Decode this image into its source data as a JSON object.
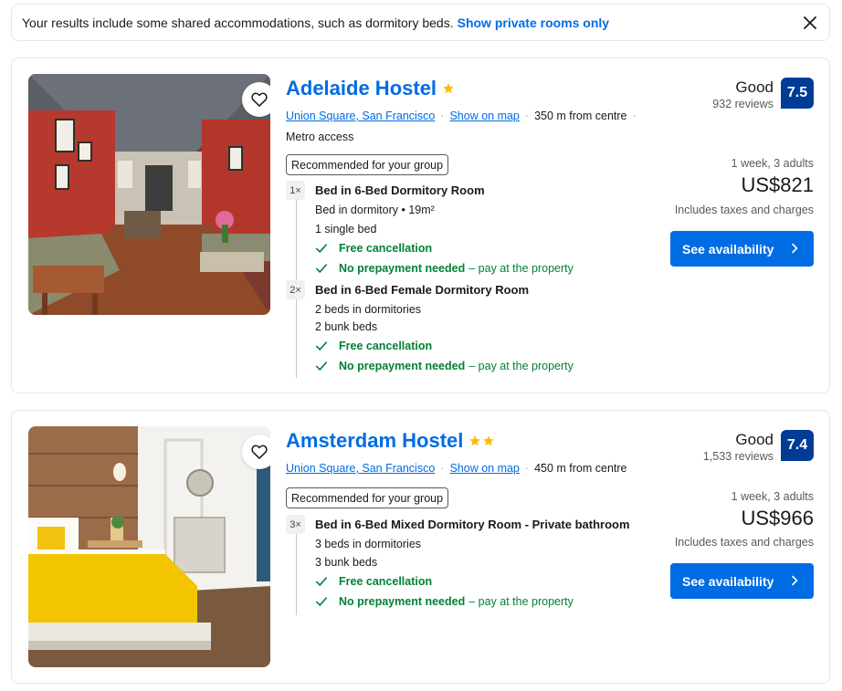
{
  "banner": {
    "text": "Your results include some shared accommodations, such as dormitory beds.",
    "link": "Show private rooms only"
  },
  "listings": [
    {
      "name": "Adelaide Hostel",
      "stars": 1,
      "neighborhood": "Union Square, San Francisco",
      "map_link": "Show on map",
      "distance": "350 m from centre",
      "metro": "Metro access",
      "badge": "Recommended for your group",
      "rating_word": "Good",
      "reviews": "932 reviews",
      "score": "7.5",
      "stay": "1 week, 3 adults",
      "price": "US$821",
      "taxes": "Includes taxes and charges",
      "cta": "See availability",
      "rooms": [
        {
          "qty": "1×",
          "name": "Bed in 6-Bed Dormitory Room",
          "lines": [
            "Bed in dormitory • 19m²",
            "1 single bed"
          ],
          "perk1": "Free cancellation",
          "perk2": "No prepayment needed",
          "perk2_rest": "– pay at the property"
        },
        {
          "qty": "2×",
          "name": "Bed in 6-Bed Female Dormitory Room",
          "lines": [
            "2 beds in dormitories",
            "2 bunk beds"
          ],
          "perk1": "Free cancellation",
          "perk2": "No prepayment needed",
          "perk2_rest": "– pay at the property"
        }
      ]
    },
    {
      "name": "Amsterdam Hostel",
      "stars": 2,
      "neighborhood": "Union Square, San Francisco",
      "map_link": "Show on map",
      "distance": "450 m from centre",
      "badge": "Recommended for your group",
      "rating_word": "Good",
      "reviews": "1,533 reviews",
      "score": "7.4",
      "stay": "1 week, 3 adults",
      "price": "US$966",
      "taxes": "Includes taxes and charges",
      "cta": "See availability",
      "rooms": [
        {
          "qty": "3×",
          "name": "Bed in 6-Bed Mixed Dormitory Room - Private bathroom",
          "lines": [
            "3 beds in dormitories",
            "3 bunk beds"
          ],
          "perk1": "Free cancellation",
          "perk2": "No prepayment needed",
          "perk2_rest": "– pay at the property"
        }
      ]
    }
  ],
  "colors": {
    "link": "#006ce4",
    "score_bg": "#003b95",
    "green": "#008234",
    "star": "#febb02"
  }
}
